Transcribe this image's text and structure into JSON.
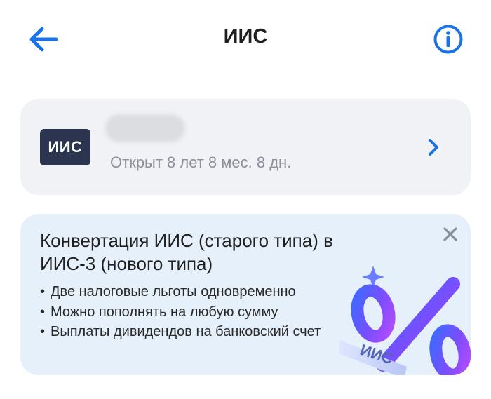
{
  "header": {
    "title": "ИИС"
  },
  "account": {
    "logo_text": "ИИС",
    "subtitle": "Открыт 8 лет 8 мес. 8 дн."
  },
  "promo": {
    "title": "Конвертация ИИС (старого типа) в ИИС-3 (нового типа)",
    "bullets": [
      "Две налоговые льготы одновременно",
      "Можно пополнять на любую сумму",
      "Выплаты дивидендов на банковский счет"
    ],
    "art_label": "ИИС"
  },
  "colors": {
    "accent": "#1a73e8",
    "card_bg": "#f1f2f5",
    "promo_bg": "#e6f0fb",
    "logo_bg": "#2b3550"
  },
  "icons": {
    "back": "arrow-left",
    "info": "info-circle",
    "chevron": "chevron-right",
    "close": "close-x"
  }
}
